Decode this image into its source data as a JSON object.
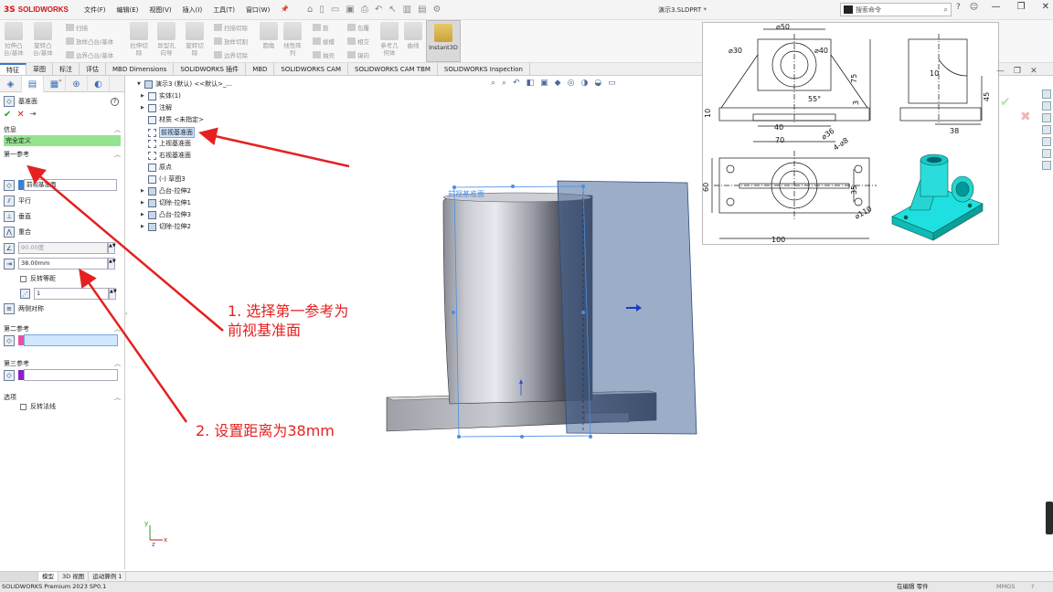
{
  "app": {
    "logo_text": "SOLIDWORKS",
    "logo_mark": "3S",
    "menu": [
      "文件(F)",
      "编辑(E)",
      "视图(V)",
      "插入(I)",
      "工具(T)",
      "窗口(W)"
    ],
    "document_title": "演示3.SLDPRT *",
    "search_placeholder": "搜索命令",
    "window_controls": [
      "—",
      "❐",
      "✕"
    ]
  },
  "ribbon": {
    "buttons": [
      {
        "label1": "拉伸凸",
        "label2": "台/基体"
      },
      {
        "label1": "旋转凸",
        "label2": "台/基体"
      },
      {
        "label1": "拉伸切",
        "label2": "除"
      },
      {
        "label1": "异型孔",
        "label2": "向导"
      },
      {
        "label1": "旋转切",
        "label2": "除"
      },
      {
        "label1": "圆角",
        "label2": ""
      },
      {
        "label1": "线性阵",
        "label2": "列"
      },
      {
        "label1": "参考几",
        "label2": "何体"
      },
      {
        "label1": "曲线",
        "label2": ""
      }
    ],
    "small_groups": [
      [
        "扫描",
        "放样凸台/基体",
        "边界凸台/基体"
      ],
      [
        "扫描切除",
        "放样切割",
        "边界切除"
      ],
      [
        "筋",
        "拔模",
        "抽壳"
      ],
      [
        "包覆",
        "相交",
        "镜向"
      ]
    ],
    "instant3d": "Instant3D"
  },
  "tabs": [
    "特征",
    "草图",
    "标注",
    "评估",
    "MBD Dimensions",
    "SOLIDWORKS 插件",
    "MBD",
    "SOLIDWORKS CAM",
    "SOLIDWORKS CAM TBM",
    "SOLIDWORKS Inspection"
  ],
  "panel": {
    "title": "基准面",
    "message_header": "信息",
    "message": "完全定义",
    "first_ref": {
      "header": "第一参考",
      "selection": "前视基准面",
      "options": [
        "平行",
        "垂直",
        "重合"
      ],
      "angle": "90.00度",
      "distance": "38.00mm",
      "flip_offset": "反转等距",
      "count": "1",
      "mid_plane": "两侧对称"
    },
    "second_ref": {
      "header": "第二参考",
      "bar_color": "#e84fa8"
    },
    "third_ref": {
      "header": "第三参考",
      "bar_color": "#8a1fd1"
    },
    "options": {
      "header": "选项",
      "flip_normal": "反转法线"
    }
  },
  "tree": {
    "root": "演示3 (默认) <<默认>_...",
    "items": [
      "实体(1)",
      "注解",
      "材质 <未指定>",
      "前视基准面",
      "上视基准面",
      "右视基准面",
      "原点",
      "(-) 草图3",
      "凸台-拉伸2",
      "切除-拉伸1",
      "凸台-拉伸3",
      "切除-拉伸2"
    ]
  },
  "viewport": {
    "plane_label": "前视基准面"
  },
  "drawing": {
    "dims": [
      "⌀50",
      "⌀30",
      "⌀40",
      "75",
      "55°",
      "3",
      "10",
      "40",
      "70",
      "⌀36",
      "4-⌀8",
      "60",
      "35",
      "⌀110",
      "100",
      "45",
      "10",
      "38"
    ]
  },
  "annotations": {
    "step1_line1": "1. 选择第一参考为",
    "step1_line2": "前视基准面",
    "step2": "2. 设置距离为38mm",
    "arrow_color": "#e62020"
  },
  "bottom_tabs": [
    "模型",
    "3D 视图",
    "运动算例 1"
  ],
  "status": {
    "left": "SOLIDWORKS Premium 2023 SP0.1",
    "mode": "在编辑 零件",
    "units": "MMGS",
    "help": "?"
  }
}
